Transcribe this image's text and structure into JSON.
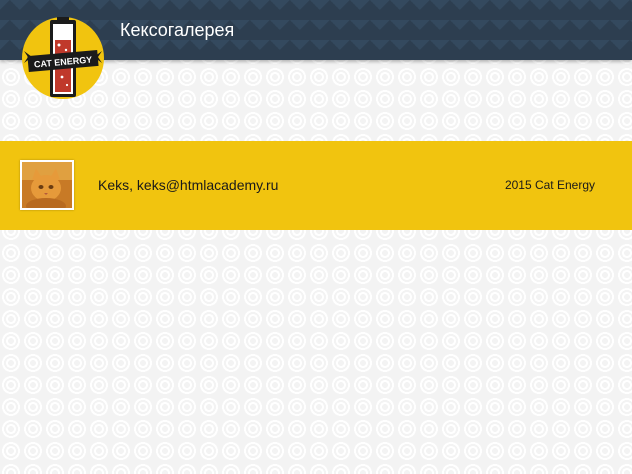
{
  "header": {
    "title": "Кексогалерея",
    "logo": {
      "text": "CAT ENERGY",
      "icon": "cat-energy-battery-logo"
    }
  },
  "footer": {
    "avatar_icon": "cat-photo",
    "author": "Keks",
    "email": "keks@htmlacademy.ru",
    "contact_text": "Keks, keks@htmlacademy.ru",
    "copyright": "2015 Cat Energy"
  },
  "colors": {
    "header_bg": "#2d3e50",
    "accent_yellow": "#f1c40f",
    "battery_red": "#c0392b"
  }
}
